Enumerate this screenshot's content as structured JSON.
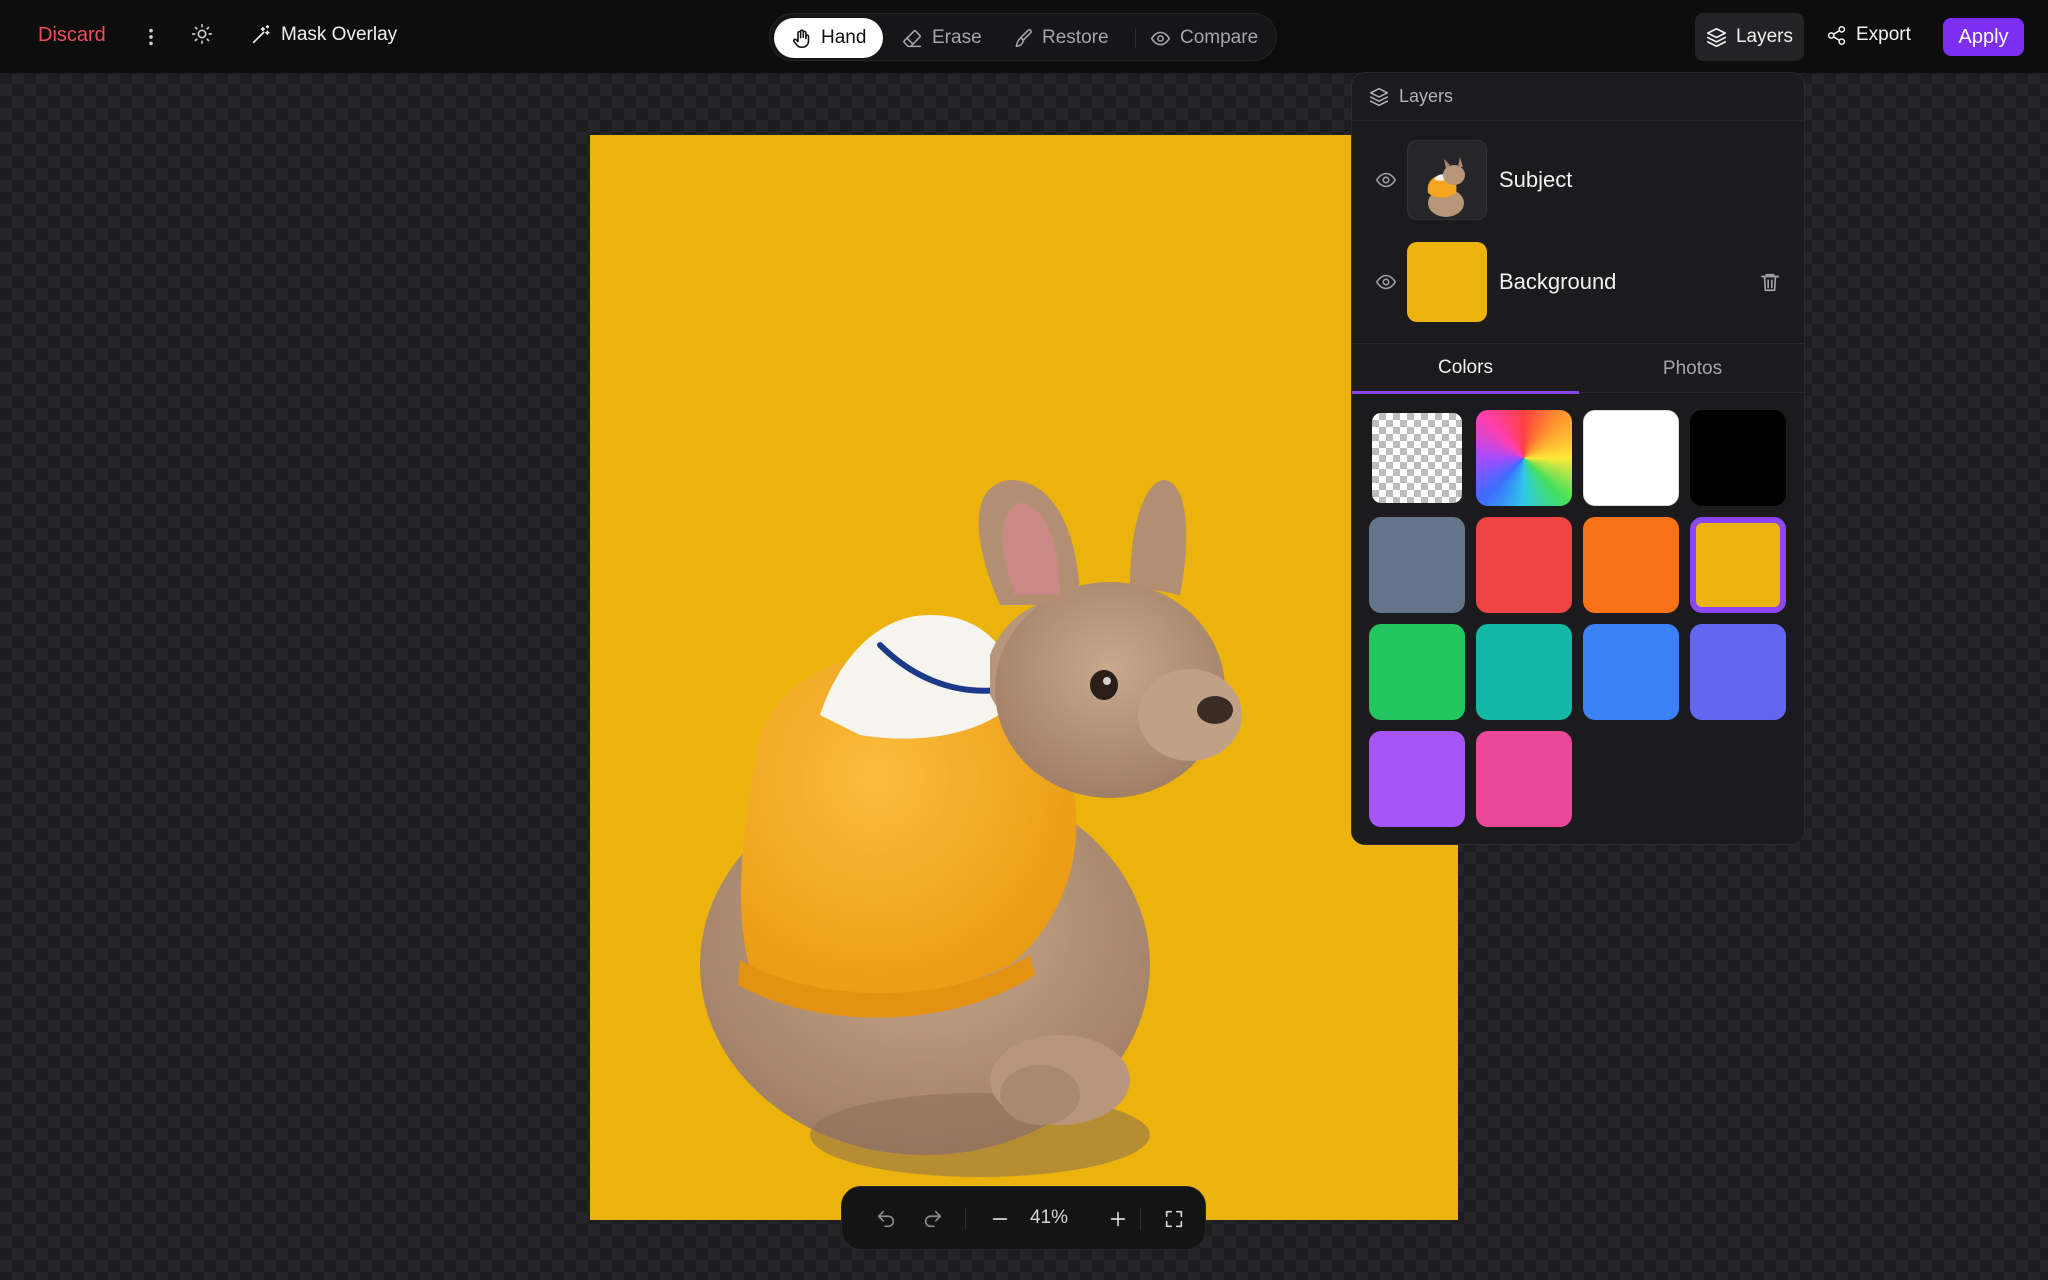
{
  "topbar": {
    "discard_label": "Discard",
    "mask_overlay_label": "Mask Overlay",
    "modes": [
      {
        "label": "Hand",
        "active": true
      },
      {
        "label": "Erase",
        "active": false
      },
      {
        "label": "Restore",
        "active": false
      },
      {
        "label": "Compare",
        "active": false
      }
    ],
    "layers_label": "Layers",
    "export_label": "Export",
    "apply_label": "Apply"
  },
  "canvas": {
    "background_color": "#ebb30b",
    "subject": "french-bulldog-in-yellow-hoodie"
  },
  "zoom": {
    "value": "41%"
  },
  "layers_panel": {
    "title": "Layers",
    "layers": [
      {
        "name": "Subject",
        "visible": true
      },
      {
        "name": "Background",
        "visible": true,
        "color": "#ebb30b"
      }
    ],
    "tabs": [
      {
        "label": "Colors",
        "active": true
      },
      {
        "label": "Photos",
        "active": false
      }
    ],
    "swatches": [
      {
        "name": "transparent"
      },
      {
        "name": "rainbow"
      },
      {
        "name": "white",
        "color": "#ffffff"
      },
      {
        "name": "black",
        "color": "#000000"
      },
      {
        "name": "slate",
        "color": "#64748b"
      },
      {
        "name": "red",
        "color": "#ef4444"
      },
      {
        "name": "orange",
        "color": "#f97316"
      },
      {
        "name": "amber",
        "color": "#ebb30b",
        "selected": true
      },
      {
        "name": "green",
        "color": "#22c55e"
      },
      {
        "name": "teal",
        "color": "#14b8a6"
      },
      {
        "name": "blue",
        "color": "#3b82f6"
      },
      {
        "name": "indigo",
        "color": "#6366f1"
      },
      {
        "name": "purple",
        "color": "#a855f7"
      },
      {
        "name": "pink",
        "color": "#ec4899"
      }
    ]
  }
}
